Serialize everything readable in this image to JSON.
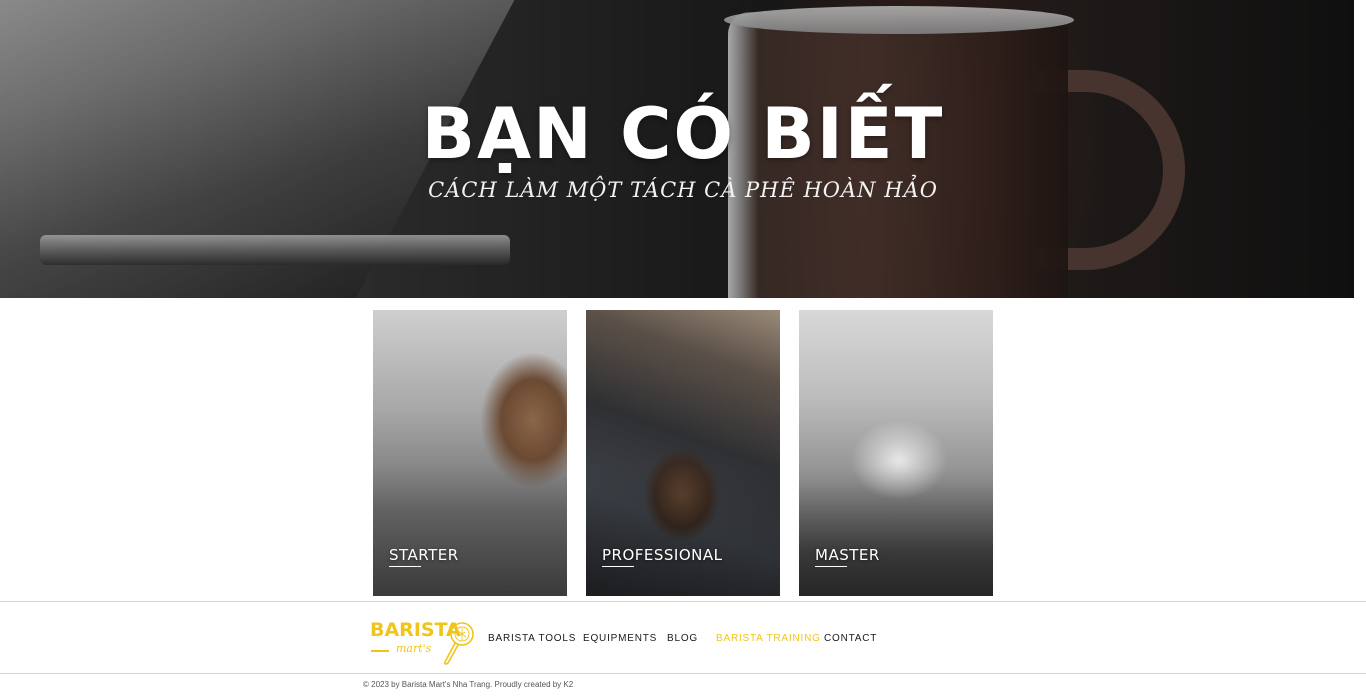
{
  "hero": {
    "title": "BẠN CÓ BIẾT",
    "subtitle": "CÁCH LÀM MỘT TÁCH CÀ PHÊ HOÀN HẢO"
  },
  "cards": [
    {
      "label": "STARTER"
    },
    {
      "label": "PROFESSIONAL"
    },
    {
      "label": "MASTER"
    }
  ],
  "footer": {
    "logo": {
      "text": "BARISTA",
      "sub": "mart's",
      "icon": "portafilter-icon"
    },
    "nav": [
      {
        "label": "BARISTA TOOLS",
        "active": false
      },
      {
        "label": "EQUIPMENTS",
        "active": false
      },
      {
        "label": "BLOG",
        "active": false
      },
      {
        "label": "BARISTA TRAINING",
        "active": true
      },
      {
        "label": "CONTACT",
        "active": false
      }
    ],
    "copyright": "© 2023 by Barista Mart's Nha Trang. Proudly created by K2"
  },
  "colors": {
    "accent": "#f0c419",
    "nav_text": "#1a1a1a",
    "divider": "#d6d6d6"
  }
}
